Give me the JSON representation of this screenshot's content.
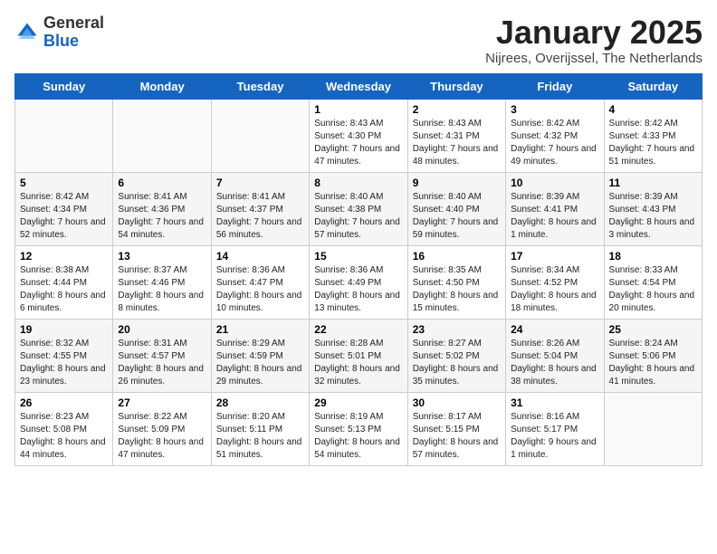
{
  "header": {
    "logo_general": "General",
    "logo_blue": "Blue",
    "month": "January 2025",
    "location": "Nijrees, Overijssel, The Netherlands"
  },
  "days_of_week": [
    "Sunday",
    "Monday",
    "Tuesday",
    "Wednesday",
    "Thursday",
    "Friday",
    "Saturday"
  ],
  "weeks": [
    [
      {
        "day": "",
        "info": ""
      },
      {
        "day": "",
        "info": ""
      },
      {
        "day": "",
        "info": ""
      },
      {
        "day": "1",
        "info": "Sunrise: 8:43 AM\nSunset: 4:30 PM\nDaylight: 7 hours and 47 minutes."
      },
      {
        "day": "2",
        "info": "Sunrise: 8:43 AM\nSunset: 4:31 PM\nDaylight: 7 hours and 48 minutes."
      },
      {
        "day": "3",
        "info": "Sunrise: 8:42 AM\nSunset: 4:32 PM\nDaylight: 7 hours and 49 minutes."
      },
      {
        "day": "4",
        "info": "Sunrise: 8:42 AM\nSunset: 4:33 PM\nDaylight: 7 hours and 51 minutes."
      }
    ],
    [
      {
        "day": "5",
        "info": "Sunrise: 8:42 AM\nSunset: 4:34 PM\nDaylight: 7 hours and 52 minutes."
      },
      {
        "day": "6",
        "info": "Sunrise: 8:41 AM\nSunset: 4:36 PM\nDaylight: 7 hours and 54 minutes."
      },
      {
        "day": "7",
        "info": "Sunrise: 8:41 AM\nSunset: 4:37 PM\nDaylight: 7 hours and 56 minutes."
      },
      {
        "day": "8",
        "info": "Sunrise: 8:40 AM\nSunset: 4:38 PM\nDaylight: 7 hours and 57 minutes."
      },
      {
        "day": "9",
        "info": "Sunrise: 8:40 AM\nSunset: 4:40 PM\nDaylight: 7 hours and 59 minutes."
      },
      {
        "day": "10",
        "info": "Sunrise: 8:39 AM\nSunset: 4:41 PM\nDaylight: 8 hours and 1 minute."
      },
      {
        "day": "11",
        "info": "Sunrise: 8:39 AM\nSunset: 4:43 PM\nDaylight: 8 hours and 3 minutes."
      }
    ],
    [
      {
        "day": "12",
        "info": "Sunrise: 8:38 AM\nSunset: 4:44 PM\nDaylight: 8 hours and 6 minutes."
      },
      {
        "day": "13",
        "info": "Sunrise: 8:37 AM\nSunset: 4:46 PM\nDaylight: 8 hours and 8 minutes."
      },
      {
        "day": "14",
        "info": "Sunrise: 8:36 AM\nSunset: 4:47 PM\nDaylight: 8 hours and 10 minutes."
      },
      {
        "day": "15",
        "info": "Sunrise: 8:36 AM\nSunset: 4:49 PM\nDaylight: 8 hours and 13 minutes."
      },
      {
        "day": "16",
        "info": "Sunrise: 8:35 AM\nSunset: 4:50 PM\nDaylight: 8 hours and 15 minutes."
      },
      {
        "day": "17",
        "info": "Sunrise: 8:34 AM\nSunset: 4:52 PM\nDaylight: 8 hours and 18 minutes."
      },
      {
        "day": "18",
        "info": "Sunrise: 8:33 AM\nSunset: 4:54 PM\nDaylight: 8 hours and 20 minutes."
      }
    ],
    [
      {
        "day": "19",
        "info": "Sunrise: 8:32 AM\nSunset: 4:55 PM\nDaylight: 8 hours and 23 minutes."
      },
      {
        "day": "20",
        "info": "Sunrise: 8:31 AM\nSunset: 4:57 PM\nDaylight: 8 hours and 26 minutes."
      },
      {
        "day": "21",
        "info": "Sunrise: 8:29 AM\nSunset: 4:59 PM\nDaylight: 8 hours and 29 minutes."
      },
      {
        "day": "22",
        "info": "Sunrise: 8:28 AM\nSunset: 5:01 PM\nDaylight: 8 hours and 32 minutes."
      },
      {
        "day": "23",
        "info": "Sunrise: 8:27 AM\nSunset: 5:02 PM\nDaylight: 8 hours and 35 minutes."
      },
      {
        "day": "24",
        "info": "Sunrise: 8:26 AM\nSunset: 5:04 PM\nDaylight: 8 hours and 38 minutes."
      },
      {
        "day": "25",
        "info": "Sunrise: 8:24 AM\nSunset: 5:06 PM\nDaylight: 8 hours and 41 minutes."
      }
    ],
    [
      {
        "day": "26",
        "info": "Sunrise: 8:23 AM\nSunset: 5:08 PM\nDaylight: 8 hours and 44 minutes."
      },
      {
        "day": "27",
        "info": "Sunrise: 8:22 AM\nSunset: 5:09 PM\nDaylight: 8 hours and 47 minutes."
      },
      {
        "day": "28",
        "info": "Sunrise: 8:20 AM\nSunset: 5:11 PM\nDaylight: 8 hours and 51 minutes."
      },
      {
        "day": "29",
        "info": "Sunrise: 8:19 AM\nSunset: 5:13 PM\nDaylight: 8 hours and 54 minutes."
      },
      {
        "day": "30",
        "info": "Sunrise: 8:17 AM\nSunset: 5:15 PM\nDaylight: 8 hours and 57 minutes."
      },
      {
        "day": "31",
        "info": "Sunrise: 8:16 AM\nSunset: 5:17 PM\nDaylight: 9 hours and 1 minute."
      },
      {
        "day": "",
        "info": ""
      }
    ]
  ]
}
